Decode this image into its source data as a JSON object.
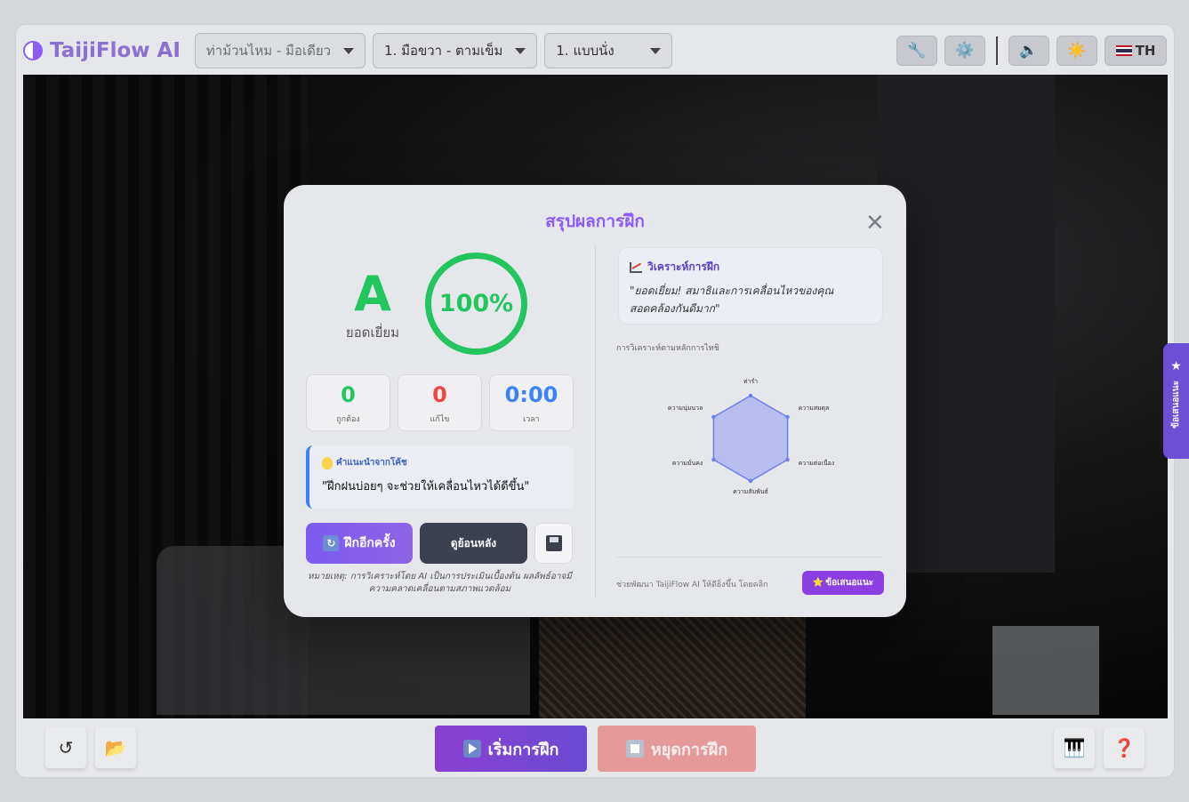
{
  "app": {
    "title": "TaijiFlow AI",
    "selects": [
      {
        "value": "ท่าม้วนไหม - มือเดียว"
      },
      {
        "value": "1. มือขวา - ตามเข็ม"
      },
      {
        "value": "1. แบบนั่ง"
      }
    ],
    "tools": {
      "wrench": "🔧",
      "gear": "⚙️",
      "sound": "🔈",
      "theme": "☀️",
      "lang": "TH"
    }
  },
  "bottom": {
    "undo": "↺",
    "folder": "📂",
    "start_label": "เริ่มการฝึก",
    "stop_label": "หยุดการฝึก",
    "piano": "🎹",
    "help": "❓"
  },
  "side_tab": {
    "label": "ข้อเสนอแนะ",
    "star": "★"
  },
  "modal": {
    "title": "สรุปผลการฝึก",
    "close": "✕",
    "grade": {
      "letter": "A",
      "label": "ยอดเยี่ยม"
    },
    "score": "100%",
    "score_value": 100,
    "stats": [
      {
        "value": "0",
        "label": "ถูกต้อง",
        "color": "#22c55e"
      },
      {
        "value": "0",
        "label": "แก้ไข",
        "color": "#ef4444"
      },
      {
        "value": "0:00",
        "label": "เวลา",
        "color": "#3b82f6"
      }
    ],
    "coach": {
      "heading": "คำแนะนำจากโค้ช",
      "text": "\"ฝึกฝนบ่อยๆ จะช่วยให้เคลื่อนไหวได้ดีขึ้น\""
    },
    "buttons": {
      "again": "ฝึกอีกครั้ง",
      "replay": "ดูย้อนหลัง"
    },
    "note": "หมายเหตุ: การวิเคราะห์โดย AI เป็นการประเมินเบื้องต้น ผลลัพธ์อาจมีความคลาดเคลื่อนตามสภาพแวดล้อม",
    "analysis": {
      "heading": "วิเคราะห์การฝึก",
      "text": "\"ยอดเยี่ยม! สมาธิและการเคลื่อนไหวของคุณสอดคล้องกันดีมาก\""
    },
    "radar": {
      "title": "การวิเคราะห์ตามหลักการไทชิ",
      "axes": [
        "ท่ารำ",
        "ความสมดุล",
        "ความต่อเนื่อง",
        "ความสัมพันธ์",
        "ความมั่นคง",
        "ความนุ่มนวล"
      ],
      "values": [
        1,
        1,
        1,
        1,
        1,
        1
      ],
      "fill": "#a5b0f0",
      "stroke": "#6b7ef0"
    },
    "footer": {
      "text": "ช่วยพัฒนา TaijiFlow AI ให้ดียิ่งขึ้น โดยคลิก",
      "button": "ข้อเสนอแนะ"
    }
  }
}
